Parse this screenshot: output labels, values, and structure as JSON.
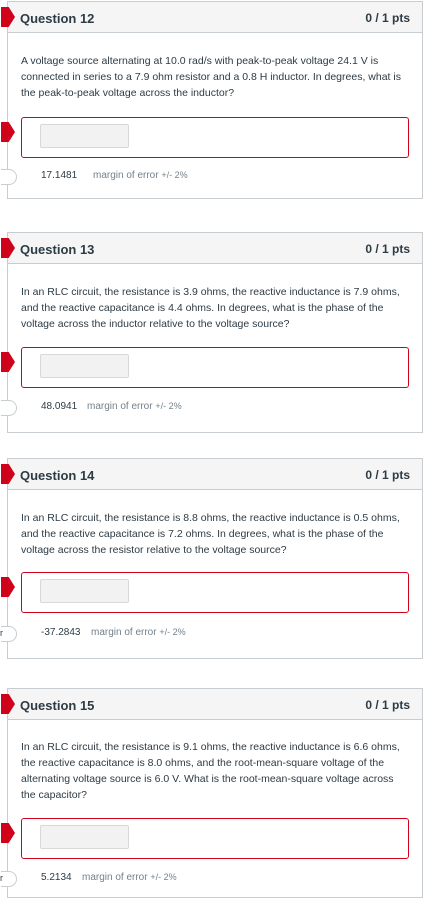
{
  "questions": [
    {
      "title": "Question 12",
      "points": "0 / 1 pts",
      "text": "A voltage source alternating at 10.0 rad/s with peak-to-peak voltage 24.1 V is connected in series to a 7.9 ohm resistor and a 0.8 H inductor. In degrees, what is the peak-to-peak voltage across the inductor?",
      "correct_answer": "17.1481",
      "margin_label": "margin of error",
      "margin_value": "+/- 2%",
      "answer_tab": ""
    },
    {
      "title": "Question 13",
      "points": "0 / 1 pts",
      "text": "In an RLC circuit, the resistance is 3.9 ohms, the reactive inductance is 7.9 ohms, and the reactive capacitance is 4.4 ohms. In degrees, what is the phase of the voltage across the inductor relative to the voltage source?",
      "correct_answer": "48.0941",
      "margin_label": "margin of error",
      "margin_value": "+/- 2%",
      "answer_tab": ""
    },
    {
      "title": "Question 14",
      "points": "0 / 1 pts",
      "text": "In an RLC circuit, the resistance is 8.8 ohms, the reactive inductance is 0.5 ohms, and the reactive capacitance is 7.2 ohms. In degrees, what is the phase of the voltage across the resistor relative to the voltage source?",
      "correct_answer": "-37.2843",
      "margin_label": "margin of error",
      "margin_value": "+/- 2%",
      "answer_tab": "r"
    },
    {
      "title": "Question 15",
      "points": "0 / 1 pts",
      "text": "In an RLC circuit, the resistance is 9.1 ohms, the reactive inductance is 6.6 ohms, the reactive capacitance is 8.0 ohms, and the root-mean-square voltage of the alternating voltage source is 6.0 V. What is the root-mean-square voltage across the capacitor?",
      "correct_answer": "5.2134",
      "margin_label": "margin of error",
      "margin_value": "+/- 2%",
      "answer_tab": "r"
    }
  ]
}
